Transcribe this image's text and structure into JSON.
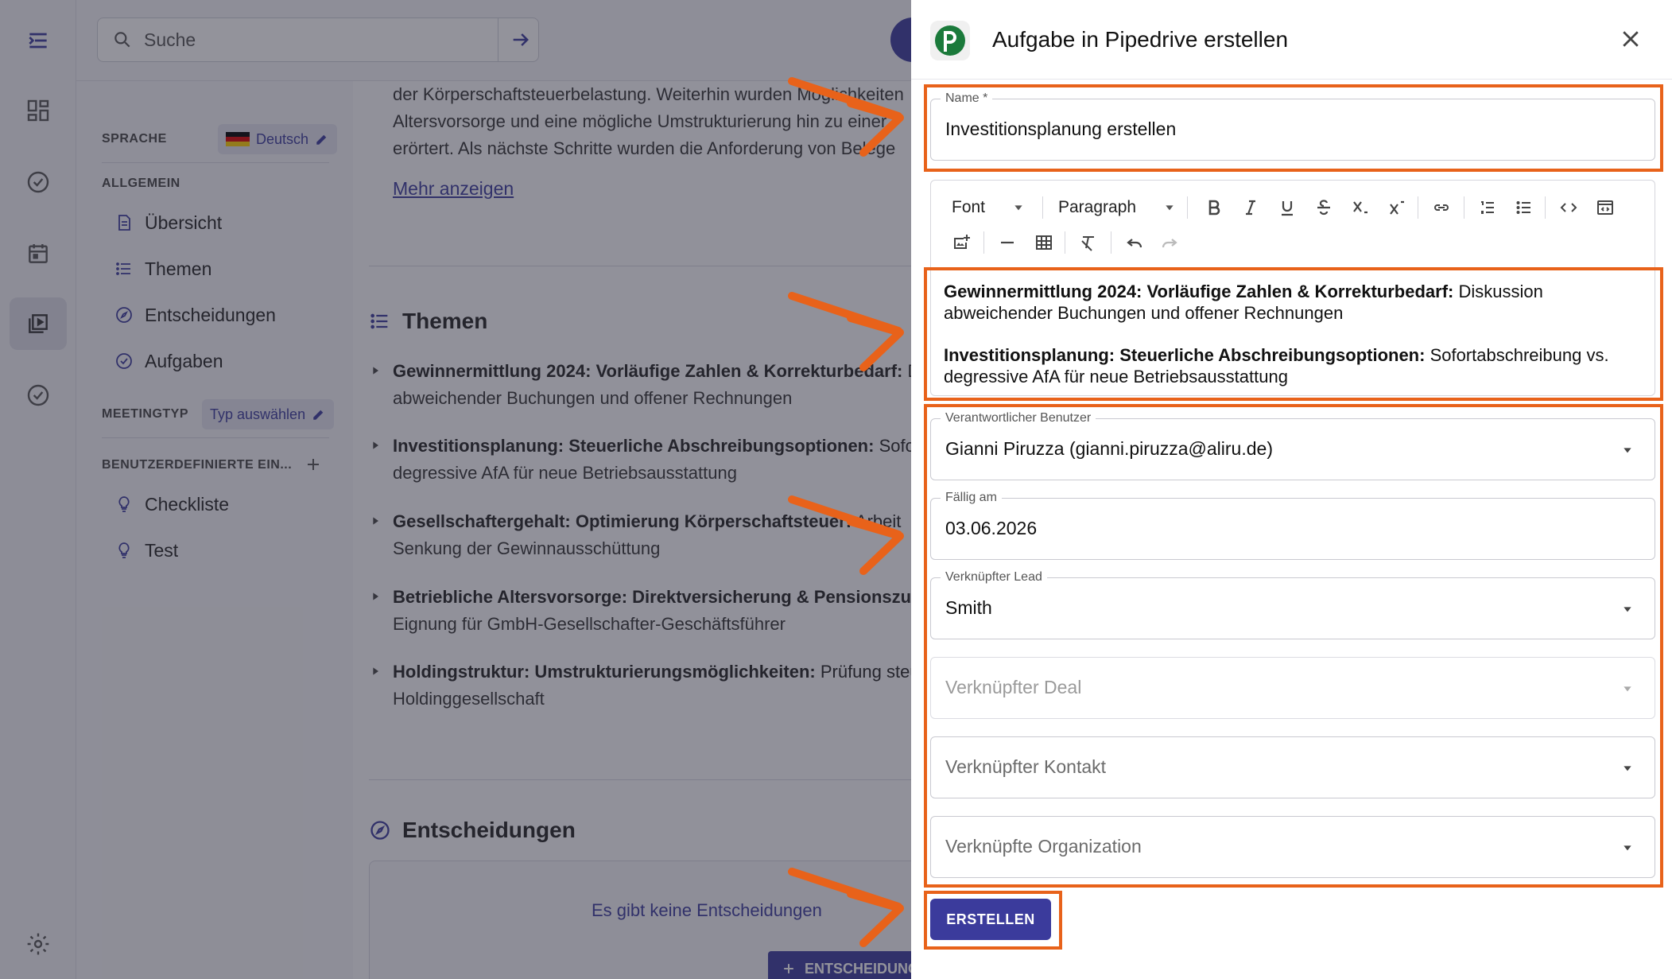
{
  "search": {
    "placeholder": "Suche"
  },
  "nav": {
    "language_heading": "SPRACHE",
    "language_value": "Deutsch",
    "general_heading": "ALLGEMEIN",
    "items": [
      {
        "label": "Übersicht",
        "icon": "document-icon"
      },
      {
        "label": "Themen",
        "icon": "list-icon"
      },
      {
        "label": "Entscheidungen",
        "icon": "compass-icon"
      },
      {
        "label": "Aufgaben",
        "icon": "check-circle-icon"
      }
    ],
    "meeting_type_heading": "MEETINGTYP",
    "meeting_type_value": "Typ auswählen",
    "custom_heading": "BENUTZERDEFINIERTE EIN...",
    "custom_items": [
      {
        "label": "Checkliste",
        "icon": "lightbulb-icon"
      },
      {
        "label": "Test",
        "icon": "lightbulb-icon"
      }
    ]
  },
  "content": {
    "summary_lines": [
      "der Körperschaftsteuerbelastung. Weiterhin wurden Möglichkeiten",
      "Altersvorsorge und eine mögliche Umstrukturierung hin zu einer",
      "erörtert. Als nächste Schritte wurden die Anforderung von Belege"
    ],
    "more_link": "Mehr anzeigen",
    "topics_title": "Themen",
    "topics": [
      {
        "bold": "Gewinnermittlung 2024",
        "bold2": ": Vorläufige Zahlen & Korrekturbedarf:",
        "rest": " D",
        "line2": "abweichender Buchungen und offener Rechnungen"
      },
      {
        "bold": "Investitionsplanung: Steuerliche Abschreibungsoptionen:",
        "bold2": "",
        "rest": " Sofort",
        "line2": "degressive AfA für neue Betriebsausstattung"
      },
      {
        "bold": "Gesellschaftergehalt: Optimierung Körperschaftsteuer:",
        "bold2": "",
        "rest": " Arbeit",
        "line2": "Senkung der Gewinnausschüttung"
      },
      {
        "bold": "Betriebliche Altersvorsorge: Direktversicherung & Pensionszusa",
        "bold2": "",
        "rest": "",
        "line2": "Eignung für GmbH-Gesellschafter-Geschäftsführer"
      },
      {
        "bold": "Holdingstruktur: Umstrukturierungsmöglichkeiten:",
        "bold2": "",
        "rest": " Prüfung steu",
        "line2": "Holdinggesellschaft"
      }
    ],
    "decisions_title": "Entscheidungen",
    "decisions_empty": "Es gibt keine Entscheidungen",
    "decisions_add": "ENTSCHEIDUNG"
  },
  "drawer": {
    "title": "Aufgabe in Pipedrive erstellen",
    "name_label": "Name *",
    "name_value": "Investitionsplanung erstellen",
    "toolbar": {
      "font": "Font",
      "paragraph": "Paragraph"
    },
    "editor": [
      {
        "bold": "Gewinnermittlung 2024: Vorläufige Zahlen & Korrekturbedarf:",
        "text": " Diskussion abweichender Buchungen und offener Rechnungen"
      },
      {
        "bold": "Investitionsplanung: Steuerliche Abschreibungsoptionen:",
        "text": " Sofortabschreibung vs. degressive AfA für neue Betriebsausstattung"
      }
    ],
    "user_label": "Verantwortlicher Benutzer",
    "user_value": "Gianni Piruzza (gianni.piruzza@aliru.de)",
    "due_label": "Fällig am",
    "due_value": "03.06.2026",
    "lead_label": "Verknüpfter Lead",
    "lead_value": "Smith",
    "deal_placeholder": "Verknüpfter Deal",
    "contact_placeholder": "Verknüpfter Kontakt",
    "org_placeholder": "Verknüpfte Organization",
    "create_label": "ERSTELLEN"
  },
  "colors": {
    "accent": "#3b3b9c",
    "annotation": "#e8621a",
    "pipedrive": "#1b7a3b"
  }
}
